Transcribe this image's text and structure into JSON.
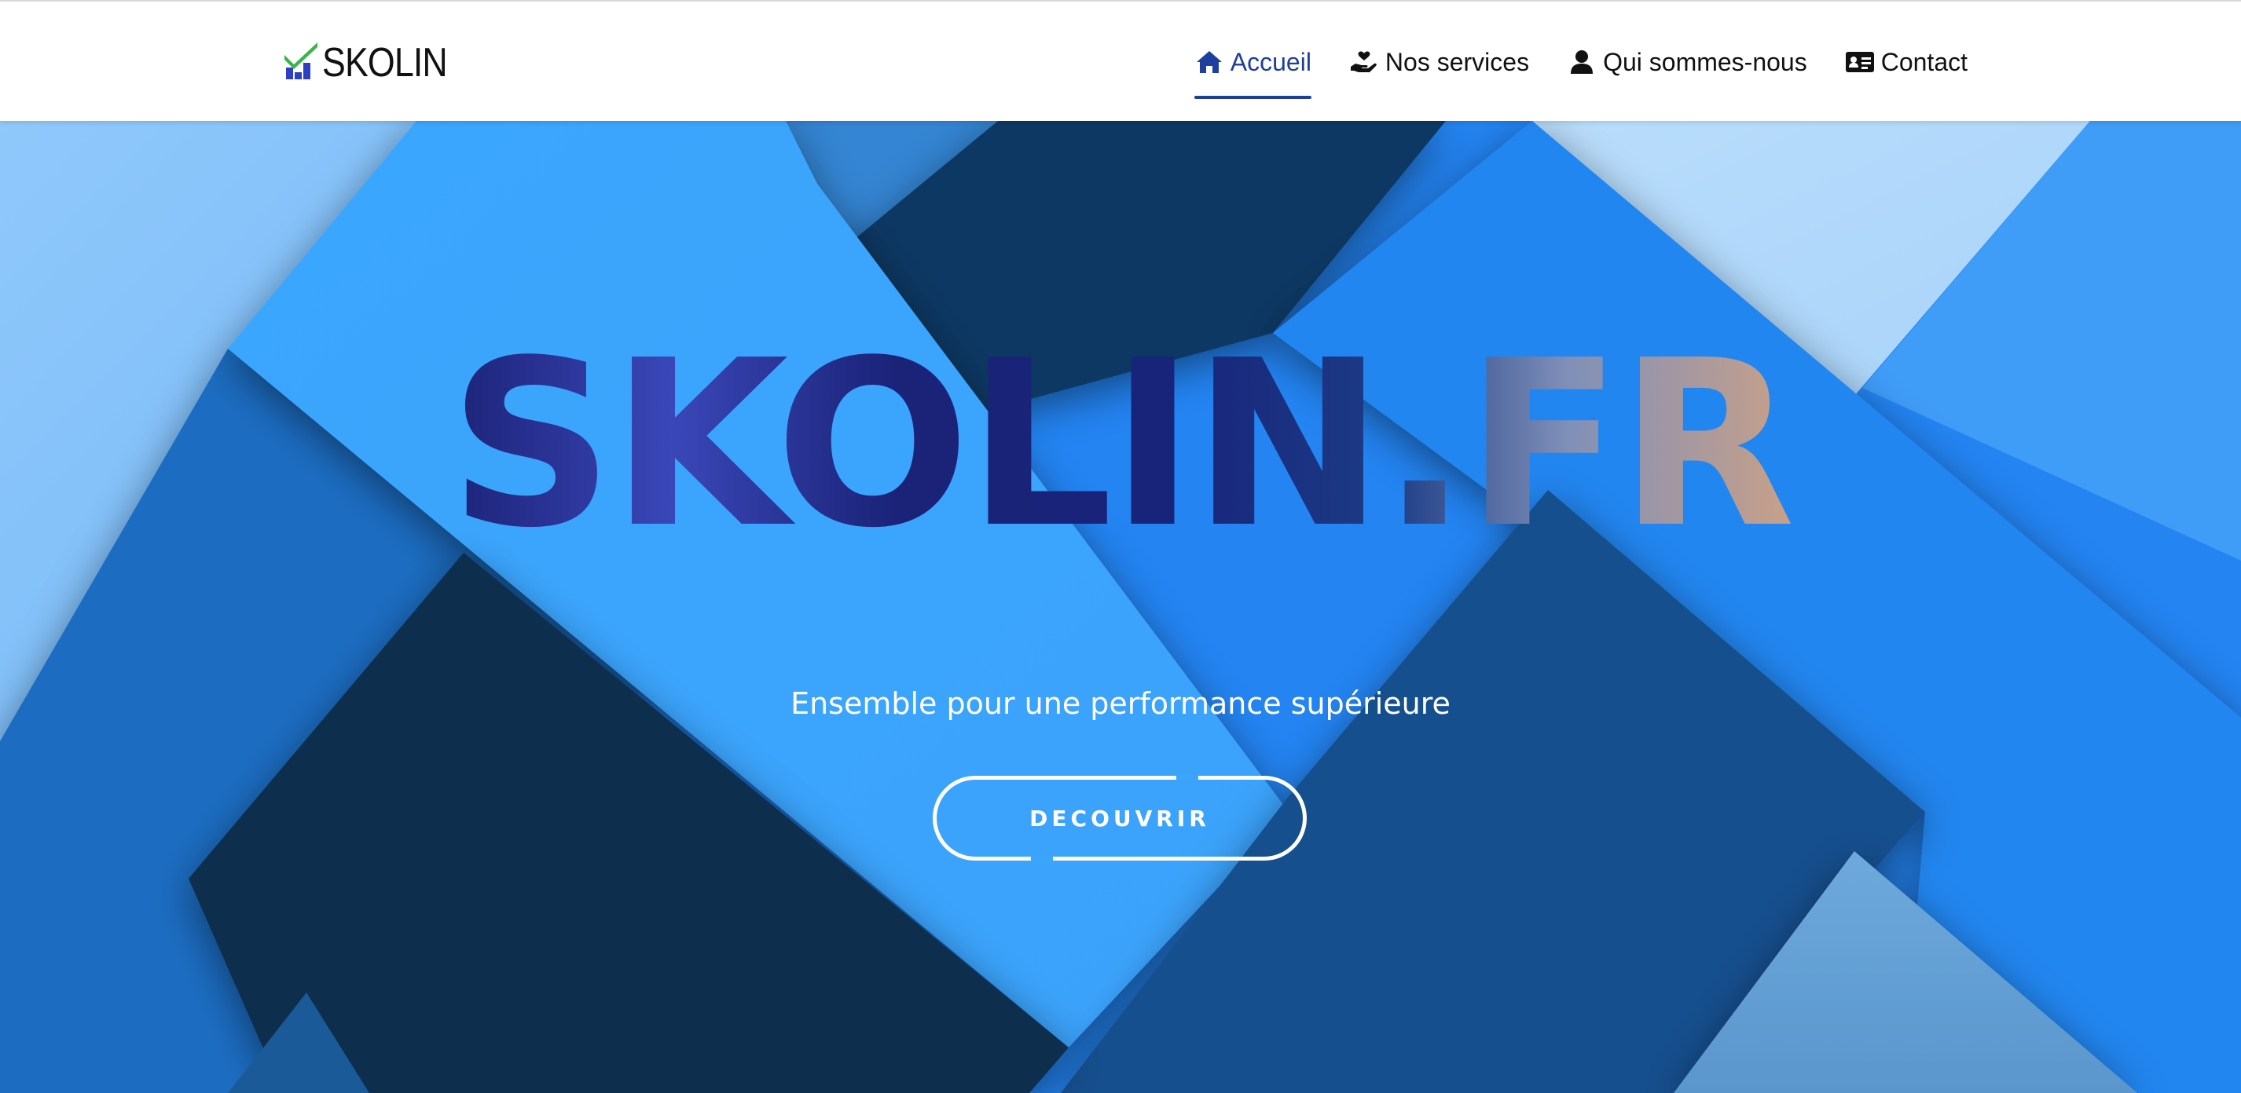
{
  "brand": {
    "name": "SKOLIN",
    "colors": {
      "check": "#3ab54a",
      "blocks": "#2d3fc4",
      "text": "#111111"
    }
  },
  "nav": {
    "items": [
      {
        "label": "Accueil",
        "icon": "home-icon",
        "active": true
      },
      {
        "label": "Nos services",
        "icon": "hand-heart-icon",
        "active": false
      },
      {
        "label": "Qui sommes-nous",
        "icon": "user-icon",
        "active": false
      },
      {
        "label": "Contact",
        "icon": "id-card-icon",
        "active": false
      }
    ],
    "active_color": "#1f3f9e"
  },
  "hero": {
    "title": "SKOLIN.FR",
    "subtitle": "Ensemble pour une performance supérieure",
    "cta_label": "DECOUVRIR"
  }
}
